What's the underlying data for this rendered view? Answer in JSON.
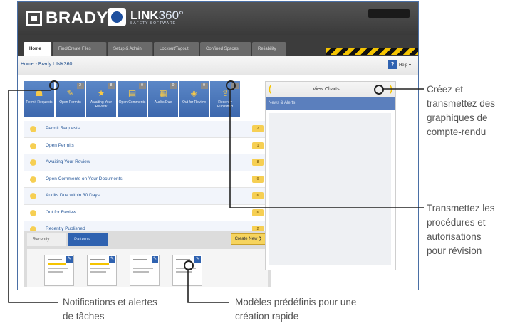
{
  "brand": {
    "brady": "BRADY",
    "link_main": "LINK",
    "link_num": "360°",
    "link_sub": "SAFETY SOFTWARE"
  },
  "tabs": [
    "Home",
    "Find/Create Files",
    "Setup & Admin",
    "Lockout/Tagout",
    "Confined Spaces",
    "Reliability"
  ],
  "breadcrumb": "Home - Brady LINK360",
  "help": {
    "icon": "?",
    "label": "Help ▾"
  },
  "tiles": [
    {
      "label": "Permit Requests",
      "count": "",
      "icon": "person-icon"
    },
    {
      "label": "Open Permits",
      "count": "2",
      "icon": "tag-icon"
    },
    {
      "label": "Awaiting Your Review",
      "count": "8",
      "icon": "star-icon"
    },
    {
      "label": "Open Comments",
      "count": "0",
      "icon": "comment-icon"
    },
    {
      "label": "Audits Due",
      "count": "0",
      "icon": "calendar-icon"
    },
    {
      "label": "Out for Review",
      "count": "0",
      "icon": "review-icon"
    },
    {
      "label": "Recently Published",
      "count": "2",
      "icon": "publish-icon"
    }
  ],
  "tile_glyphs": [
    "☗",
    "✎",
    "★",
    "▤",
    "▦",
    "◈",
    "⇪"
  ],
  "list": [
    {
      "label": "Permit Requests",
      "count": "2"
    },
    {
      "label": "Open Permits",
      "count": "1"
    },
    {
      "label": "Awaiting Your Review",
      "count": "8"
    },
    {
      "label": "Open Comments on Your Documents",
      "count": "9"
    },
    {
      "label": "Audits Due within 30 Days",
      "count": "6"
    },
    {
      "label": "Out for Review",
      "count": "6"
    },
    {
      "label": "Recently Published",
      "count": "2"
    }
  ],
  "recent": {
    "tab1": "Recently Viewed",
    "tab2": "Patterns",
    "create": "Create New ❯"
  },
  "right": {
    "view_charts": "View Charts",
    "news": "News & Alerts"
  },
  "callouts": {
    "charts": [
      "Créez et",
      "transmettez des",
      "graphiques de",
      "compte-rendu"
    ],
    "review": [
      "Transmettez les",
      "procédures et",
      "autorisations",
      "pour révision"
    ],
    "notifications": [
      "Notifications et alertes",
      "de tâches"
    ],
    "templates": [
      "Modèles prédéfinis pour une",
      "création rapide"
    ]
  },
  "colors": {
    "accent_blue": "#3d68ad",
    "hazard_yellow": "#f5c400",
    "count_yellow": "#f6cf53",
    "topbar": "#3a3a3a"
  }
}
